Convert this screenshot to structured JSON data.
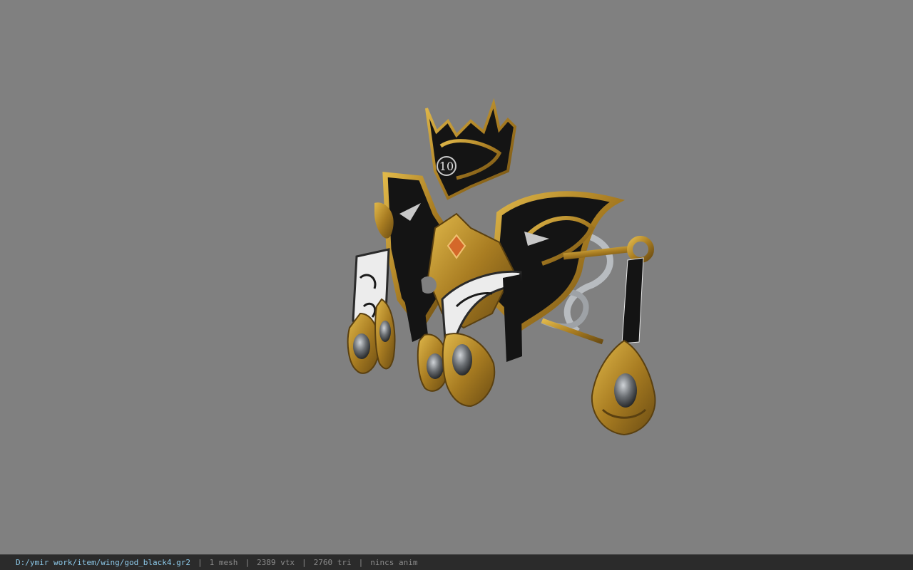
{
  "viewer": {
    "background_color": "#808080",
    "model_icon": "winged-crown-ornament-model"
  },
  "statusbar": {
    "file_path": "D:/ymir work/item/wing/god_black4.gr2",
    "separator": "|",
    "mesh_count": "1 mesh",
    "vertex_count": "2389 vtx",
    "triangle_count": "2760 tri",
    "anim_status": "nincs anim"
  },
  "model": {
    "emblem_text": "10",
    "gold_color": "#b08a2a",
    "dark_color": "#141414",
    "silver_color": "#b8bcc0",
    "ribbon_color": "#e8e8e8"
  }
}
